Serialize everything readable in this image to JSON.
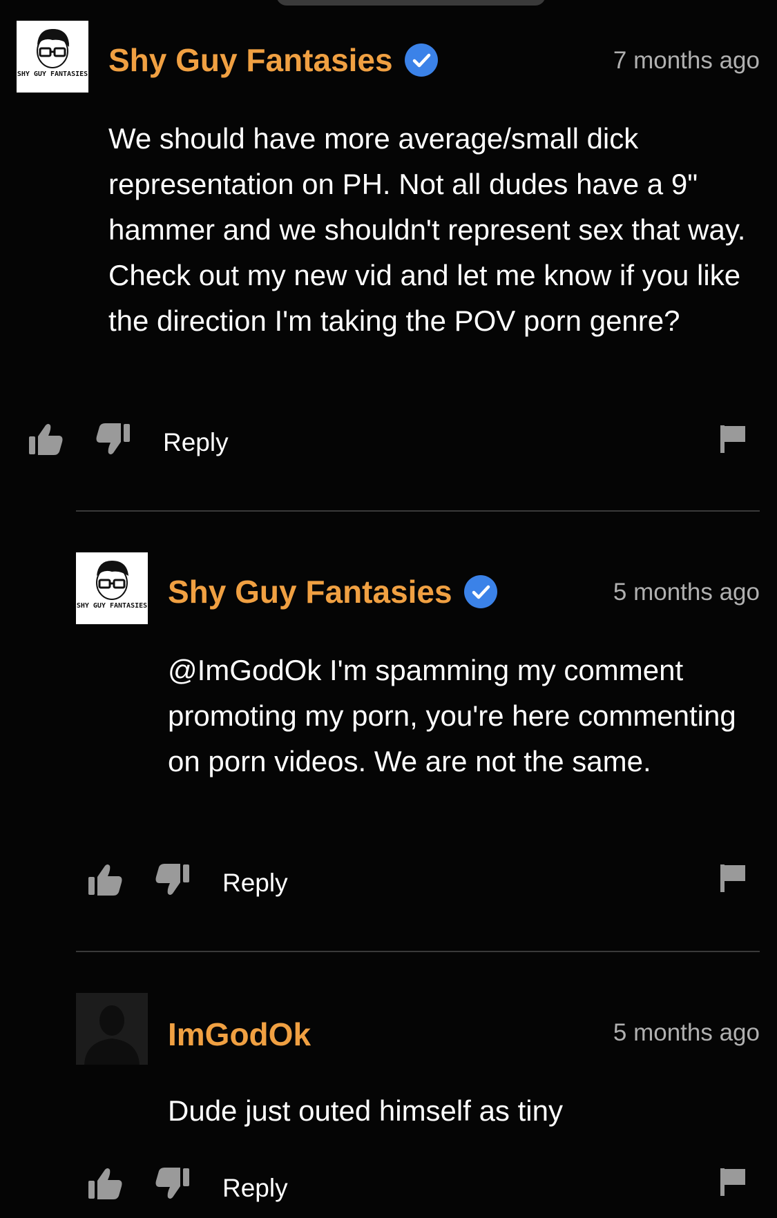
{
  "comments": [
    {
      "username": "Shy Guy Fantasies",
      "verified": true,
      "avatar_icon": "shy-guy-fantasies-logo",
      "avatar_text": "SHY GUY FANTASIES",
      "timestamp": "7 months ago",
      "text": "We should have more average/small dick representation on PH. Not all dudes have a 9\" hammer and we shouldn't represent sex that way. Check out my new vid and let me know if you like the direction I'm taking the POV porn genre?",
      "reply_label": "Reply"
    },
    {
      "username": "Shy Guy Fantasies",
      "verified": true,
      "avatar_icon": "shy-guy-fantasies-logo",
      "avatar_text": "SHY GUY FANTASIES",
      "timestamp": "5 months ago",
      "text": "@ImGodOk I'm spamming my comment promoting my porn, you're here commenting on porn videos. We are not the same.",
      "reply_label": "Reply"
    },
    {
      "username": "ImGodOk",
      "verified": false,
      "avatar_icon": "default-user-silhouette",
      "timestamp": "5 months ago",
      "text": "Dude just outed himself as tiny",
      "reply_label": "Reply"
    }
  ],
  "colors": {
    "background": "#050505",
    "username": "#f0a042",
    "verified_badge": "#3b82e8",
    "timestamp": "#b0b0b0",
    "icon": "#9a9a9a",
    "divider": "#3a3a3a"
  },
  "icons": [
    "thumbs-up-icon",
    "thumbs-down-icon",
    "flag-icon",
    "verified-badge-icon"
  ]
}
